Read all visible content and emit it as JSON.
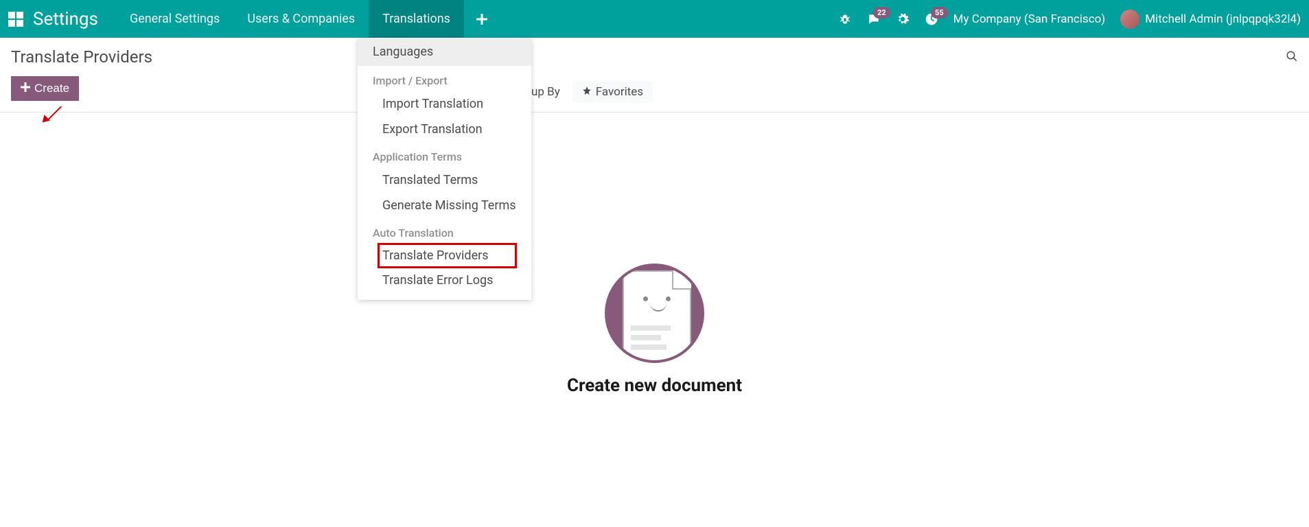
{
  "navbar": {
    "brand": "Settings",
    "menu": [
      {
        "label": "General Settings",
        "active": false
      },
      {
        "label": "Users & Companies",
        "active": false
      },
      {
        "label": "Translations",
        "active": true
      }
    ],
    "debug_badge": "",
    "messages_badge": "22",
    "activities_badge": "55",
    "company": "My Company (San Francisco)",
    "user": "Mitchell Admin (jnlpqpqk32l4)"
  },
  "dropdown": {
    "items": [
      {
        "type": "item",
        "label": "Languages",
        "hover": true
      },
      {
        "type": "header",
        "label": "Import / Export"
      },
      {
        "type": "sub",
        "label": "Import Translation"
      },
      {
        "type": "sub",
        "label": "Export Translation"
      },
      {
        "type": "header",
        "label": "Application Terms"
      },
      {
        "type": "sub",
        "label": "Translated Terms"
      },
      {
        "type": "sub",
        "label": "Generate Missing Terms"
      },
      {
        "type": "header",
        "label": "Auto Translation"
      },
      {
        "type": "sub",
        "label": "Translate Providers",
        "highlighted": true
      },
      {
        "type": "sub",
        "label": "Translate Error Logs"
      }
    ]
  },
  "controlbar": {
    "title": "Translate Providers",
    "create_label": "Create",
    "filters": {
      "group_by": "up By",
      "favorites": "Favorites"
    }
  },
  "empty": {
    "title": "Create new document"
  }
}
